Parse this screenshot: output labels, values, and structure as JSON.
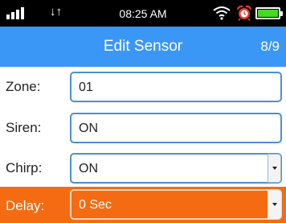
{
  "status_bar": {
    "time": "08:25 AM",
    "data_arrows": "↓↑",
    "icons": [
      "signal-icon",
      "data-transfer-icon",
      "wifi-icon",
      "alarm-clock-icon",
      "battery-icon"
    ],
    "battery_level": 1.0,
    "battery_color": "#46d91e"
  },
  "header": {
    "title": "Edit Sensor",
    "page_indicator": "8/9",
    "color": "#3b97f5"
  },
  "form": {
    "zone": {
      "label": "Zone:",
      "value": "01"
    },
    "siren": {
      "label": "Siren:",
      "value": "ON"
    },
    "chirp": {
      "label": "Chirp:",
      "value": "ON",
      "icon": "chevron-down-icon"
    },
    "delay": {
      "label": "Delay:",
      "value": "0 Sec",
      "icon": "chevron-down-icon",
      "highlight_color": "#f46b12"
    }
  }
}
